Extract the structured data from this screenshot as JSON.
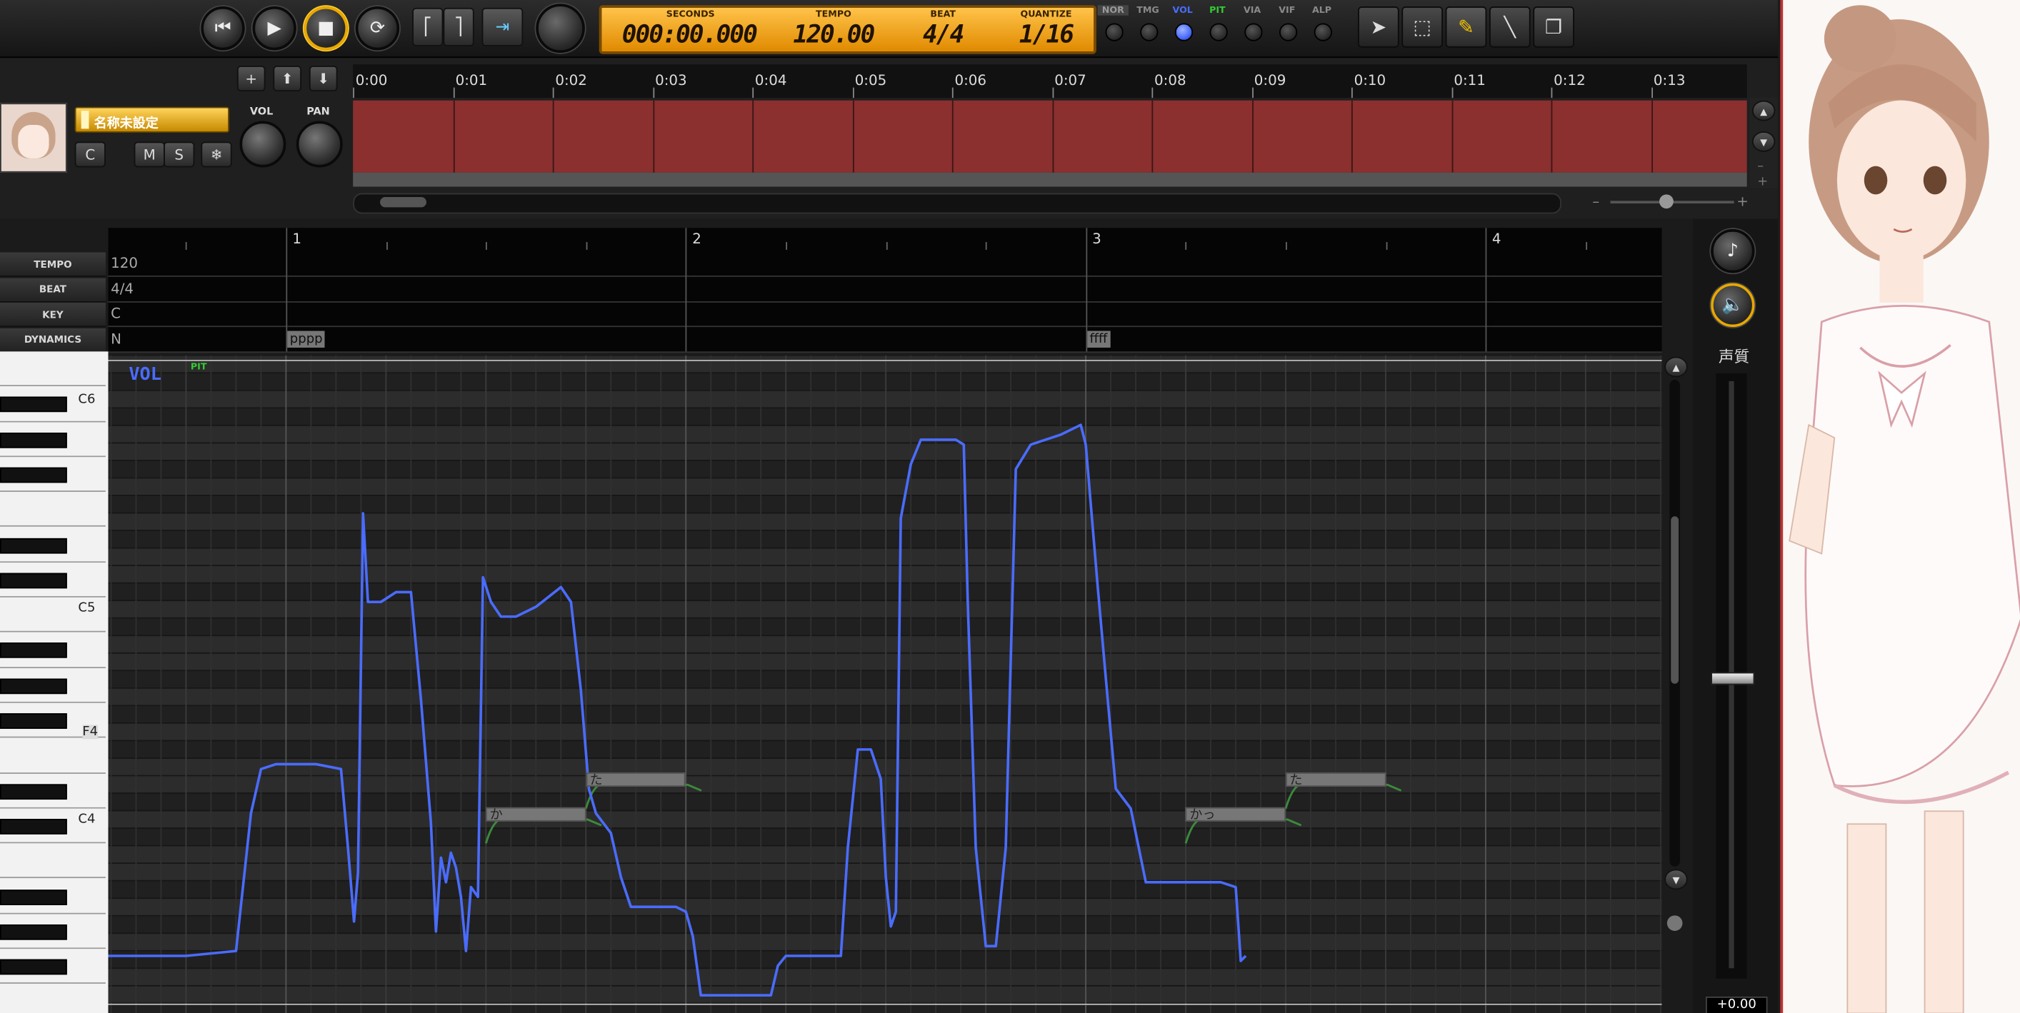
{
  "transport": {
    "lcd": {
      "seconds_label": "SECONDS",
      "seconds": "000:00.000",
      "tempo_label": "TEMPO",
      "tempo": "120.00",
      "beat_label": "BEAT",
      "beat": "4/4",
      "quantize_label": "QUANTIZE",
      "quantize": "1/16"
    }
  },
  "param_tabs": [
    "NOR",
    "TMG",
    "VOL",
    "PIT",
    "VIA",
    "VIF",
    "ALP"
  ],
  "active_param_tab": "VOL",
  "colors": {
    "accent": "#4a6cff",
    "pit_tab": "#33cc33",
    "track_block": "#8b2f2f",
    "lcd": "#ffb020",
    "pitch_line": "#3c8a3c"
  },
  "timeline": {
    "labels": [
      "0:00",
      "0:01",
      "0:02",
      "0:03",
      "0:04",
      "0:05",
      "0:06",
      "0:07",
      "0:08",
      "0:09",
      "0:10",
      "0:11",
      "0:12",
      "0:13"
    ]
  },
  "track": {
    "name": "名称未設定",
    "vol_label": "VOL",
    "pan_label": "PAN",
    "buttons": [
      "C",
      "M",
      "S"
    ]
  },
  "measures": [
    "1",
    "2",
    "3",
    "4"
  ],
  "lanes": {
    "tempo": {
      "label": "TEMPO",
      "value": "120"
    },
    "beat": {
      "label": "BEAT",
      "value": "4/4"
    },
    "key": {
      "label": "KEY",
      "value": "C"
    },
    "dynamics": {
      "label": "DYNAMICS",
      "value": "N",
      "marks": [
        {
          "text": "pppp",
          "beat": 0
        },
        {
          "text": "ffff",
          "beat": 8
        }
      ]
    }
  },
  "editor": {
    "mode_label": "VOL",
    "sub_label": "PIT"
  },
  "keys": {
    "c6": "C6",
    "c5": "C5",
    "f4": "F4",
    "c4": "C4"
  },
  "notes": [
    {
      "lyric": "か",
      "start_beat": 2.0,
      "end_beat": 3.0,
      "pitch": "C4"
    },
    {
      "lyric": "た",
      "start_beat": 3.0,
      "end_beat": 4.0,
      "pitch": "E4"
    },
    {
      "lyric": "かっ",
      "start_beat": 9.0,
      "end_beat": 10.0,
      "pitch": "C4"
    },
    {
      "lyric": "た",
      "start_beat": 10.0,
      "end_beat": 11.0,
      "pitch": "E4"
    }
  ],
  "side": {
    "voice_quality_label": "声質",
    "slider_value": "+0.00"
  },
  "volume_curve": {
    "y_range": [
      0,
      127
    ],
    "points": [
      [
        -2.0,
        8
      ],
      [
        -1.0,
        8
      ],
      [
        -0.5,
        9
      ],
      [
        -0.35,
        37
      ],
      [
        -0.25,
        46
      ],
      [
        -0.1,
        47
      ],
      [
        0.3,
        47
      ],
      [
        0.55,
        46
      ],
      [
        0.62,
        30
      ],
      [
        0.68,
        15
      ],
      [
        0.72,
        25
      ],
      [
        0.77,
        98
      ],
      [
        0.82,
        80
      ],
      [
        0.95,
        80
      ],
      [
        1.1,
        82
      ],
      [
        1.25,
        82
      ],
      [
        1.35,
        60
      ],
      [
        1.45,
        35
      ],
      [
        1.5,
        13
      ],
      [
        1.55,
        28
      ],
      [
        1.6,
        23
      ],
      [
        1.65,
        29
      ],
      [
        1.7,
        26
      ],
      [
        1.75,
        20
      ],
      [
        1.8,
        9
      ],
      [
        1.85,
        22
      ],
      [
        1.92,
        20
      ],
      [
        1.97,
        85
      ],
      [
        2.05,
        80
      ],
      [
        2.15,
        77
      ],
      [
        2.3,
        77
      ],
      [
        2.5,
        79
      ],
      [
        2.75,
        83
      ],
      [
        2.85,
        80
      ],
      [
        2.95,
        62
      ],
      [
        3.03,
        42
      ],
      [
        3.1,
        37
      ],
      [
        3.25,
        33
      ],
      [
        3.35,
        24
      ],
      [
        3.45,
        18
      ],
      [
        3.7,
        18
      ],
      [
        3.9,
        18
      ],
      [
        4.0,
        17
      ],
      [
        4.07,
        12
      ],
      [
        4.15,
        0
      ],
      [
        4.4,
        0
      ],
      [
        4.75,
        0
      ],
      [
        4.85,
        0
      ],
      [
        4.92,
        6
      ],
      [
        5.0,
        8
      ],
      [
        5.3,
        8
      ],
      [
        5.55,
        8
      ],
      [
        5.62,
        30
      ],
      [
        5.72,
        50
      ],
      [
        5.85,
        50
      ],
      [
        5.95,
        44
      ],
      [
        6.0,
        24
      ],
      [
        6.05,
        14
      ],
      [
        6.1,
        17
      ],
      [
        6.15,
        97
      ],
      [
        6.25,
        108
      ],
      [
        6.35,
        113
      ],
      [
        6.7,
        113
      ],
      [
        6.78,
        112
      ],
      [
        6.82,
        80
      ],
      [
        6.9,
        30
      ],
      [
        7.0,
        10
      ],
      [
        7.1,
        10
      ],
      [
        7.2,
        30
      ],
      [
        7.3,
        107
      ],
      [
        7.45,
        112
      ],
      [
        7.75,
        114
      ],
      [
        7.95,
        116
      ],
      [
        8.0,
        112
      ],
      [
        8.12,
        83
      ],
      [
        8.22,
        60
      ],
      [
        8.3,
        42
      ],
      [
        8.45,
        38
      ],
      [
        8.55,
        28
      ],
      [
        8.6,
        23
      ],
      [
        9.0,
        23
      ],
      [
        9.35,
        23
      ],
      [
        9.5,
        22
      ],
      [
        9.55,
        7
      ],
      [
        9.6,
        8
      ]
    ]
  }
}
